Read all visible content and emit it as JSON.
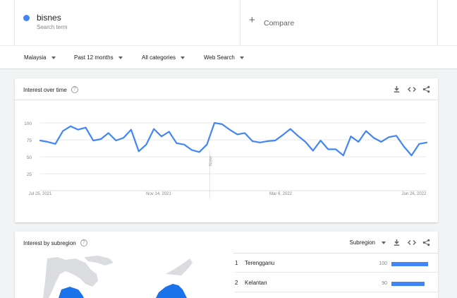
{
  "term": {
    "name": "bisnes",
    "subtitle": "Search term",
    "color": "#4285f4"
  },
  "compare": {
    "label": "Compare",
    "icon": "plus-icon"
  },
  "filters": [
    {
      "label": "Malaysia"
    },
    {
      "label": "Past 12 months"
    },
    {
      "label": "All categories"
    },
    {
      "label": "Web Search"
    }
  ],
  "interest_over_time": {
    "title": "Interest over time",
    "help_icon": "help-icon",
    "actions": [
      "download-icon",
      "embed-icon",
      "share-icon"
    ],
    "note_label": "Note"
  },
  "chart_data": {
    "type": "line",
    "x_labels": [
      "Jul 25, 2021",
      "Nov 14, 2021",
      "Mar 6, 2022",
      "Jun 26, 2022"
    ],
    "y_ticks": [
      25,
      50,
      75,
      100
    ],
    "ylim": [
      0,
      100
    ],
    "grid": true,
    "series": [
      {
        "color": "#4285f4",
        "values": [
          74,
          72,
          69,
          88,
          95,
          90,
          93,
          74,
          76,
          85,
          74,
          78,
          90,
          58,
          68,
          91,
          80,
          87,
          70,
          68,
          60,
          57,
          68,
          100,
          98,
          90,
          83,
          85,
          73,
          71,
          73,
          74,
          82,
          91,
          81,
          72,
          59,
          74,
          61,
          61,
          52,
          80,
          72,
          88,
          78,
          72,
          79,
          81,
          65,
          52,
          69,
          71
        ]
      }
    ]
  },
  "interest_by_subregion": {
    "title": "Interest by subregion",
    "help_icon": "help-icon",
    "selector_label": "Subregion",
    "actions": [
      "download-icon",
      "embed-icon",
      "share-icon"
    ],
    "rows": [
      {
        "rank": "1",
        "name": "Terengganu",
        "value": "100",
        "fraction": 1.0
      },
      {
        "rank": "2",
        "name": "Kelantan",
        "value": "90",
        "fraction": 0.9
      }
    ]
  }
}
